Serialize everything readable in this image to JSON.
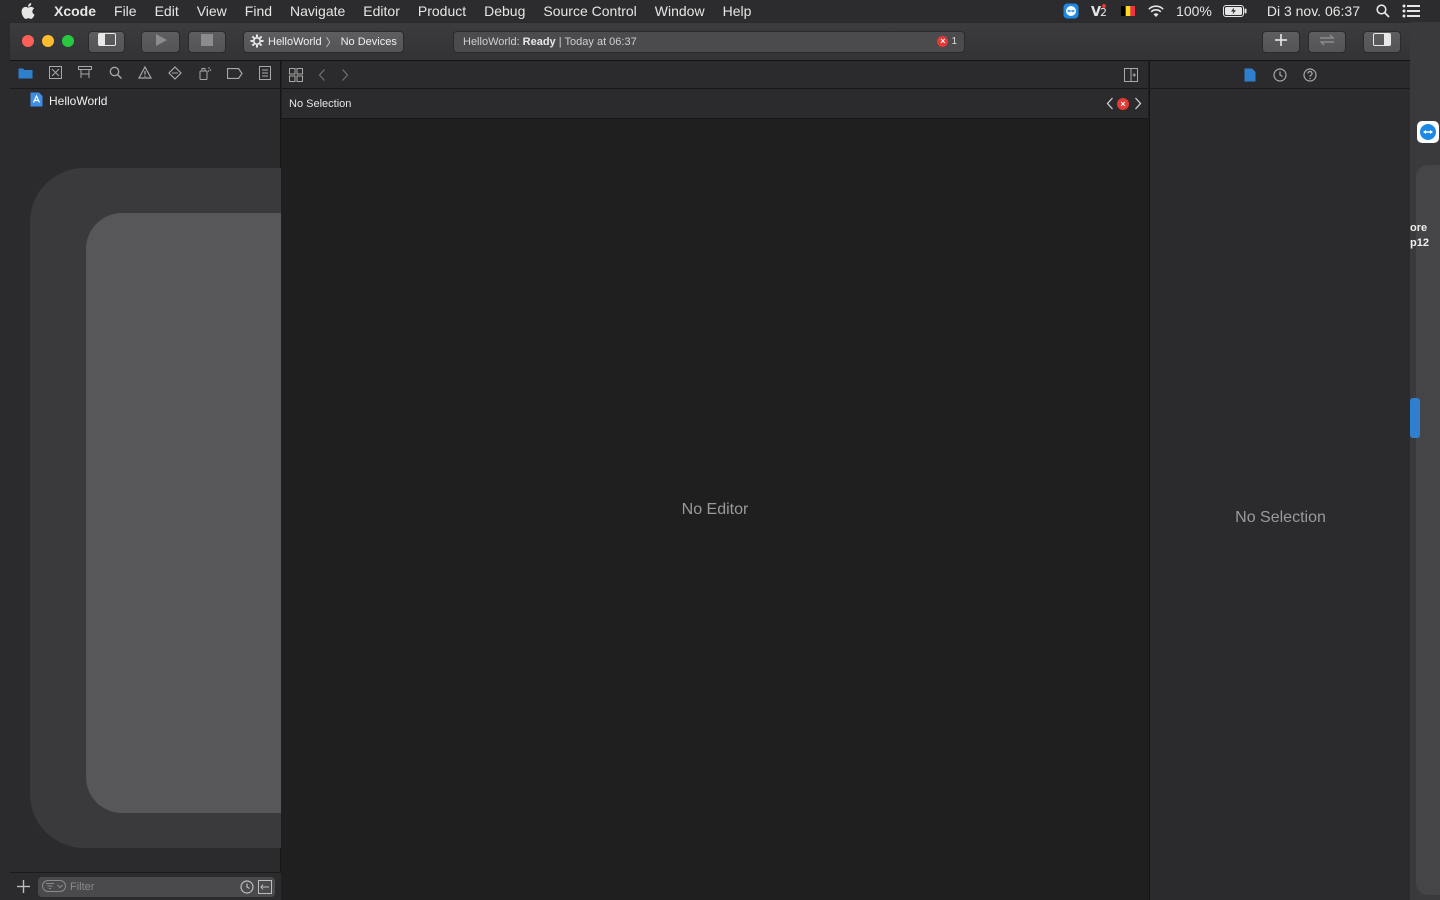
{
  "menubar": {
    "app": "Xcode",
    "items": [
      "File",
      "Edit",
      "View",
      "Find",
      "Navigate",
      "Editor",
      "Product",
      "Debug",
      "Source Control",
      "Window",
      "Help"
    ],
    "battery": "100%",
    "datetime": "Di 3 nov.  06:37",
    "icons": [
      "teamviewer-icon",
      "vpn-icon",
      "flag-icon",
      "wifi-icon",
      "battery-icon",
      "spotlight-icon",
      "notification-center-icon"
    ]
  },
  "toolbar": {
    "scheme": "HelloWorld",
    "destination": "No Devices",
    "activity_project": "HelloWorld:",
    "activity_status": "Ready",
    "activity_time": "Today at 06:37",
    "error_count": "1"
  },
  "navigator": {
    "project_name": "HelloWorld",
    "filter_placeholder": "Filter",
    "tabs": [
      "project-navigator",
      "source-control-navigator",
      "symbol-navigator",
      "find-navigator",
      "issue-navigator",
      "test-navigator",
      "debug-navigator",
      "breakpoint-navigator",
      "report-navigator"
    ]
  },
  "editor": {
    "jump_label": "No Selection",
    "empty_message": "No Editor"
  },
  "inspector": {
    "empty_message": "No Selection"
  },
  "desktop": {
    "label_line1": "ore",
    "label_line2": "p12"
  },
  "colors": {
    "accent": "#2f7fcf",
    "error": "#e53935",
    "close": "#fe5f57",
    "minimize": "#febc2e",
    "maximize": "#28c840"
  }
}
